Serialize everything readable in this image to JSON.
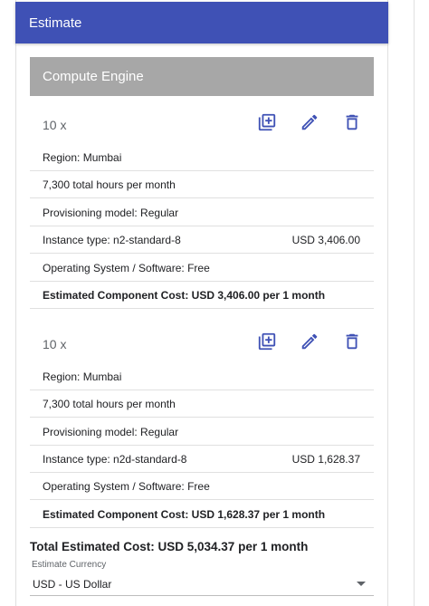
{
  "header": {
    "title": "Estimate"
  },
  "section": {
    "title": "Compute Engine"
  },
  "items": [
    {
      "quantity": "10 x",
      "region": "Region: Mumbai",
      "hours": "7,300 total hours per month",
      "provisioning": "Provisioning model: Regular",
      "instance_type": "Instance type: n2-standard-8",
      "instance_price": "USD 3,406.00",
      "os": "Operating System / Software: Free",
      "component_cost": "Estimated Component Cost: USD 3,406.00 per 1 month"
    },
    {
      "quantity": "10 x",
      "region": "Region: Mumbai",
      "hours": "7,300 total hours per month",
      "provisioning": "Provisioning model: Regular",
      "instance_type": "Instance type: n2d-standard-8",
      "instance_price": "USD 1,628.37",
      "os": "Operating System / Software: Free",
      "component_cost": "Estimated Component Cost: USD 1,628.37 per 1 month"
    }
  ],
  "total": {
    "text": "Total Estimated Cost: USD 5,034.37 per 1 month"
  },
  "currency": {
    "label": "Estimate Currency",
    "value": "USD - US Dollar"
  },
  "colors": {
    "header": "#3f51b5",
    "icon": "#3f51b5",
    "section_bar": "#a7a7a7"
  },
  "icons": [
    "duplicate-icon",
    "edit-icon",
    "delete-icon",
    "dropdown-arrow-icon"
  ]
}
